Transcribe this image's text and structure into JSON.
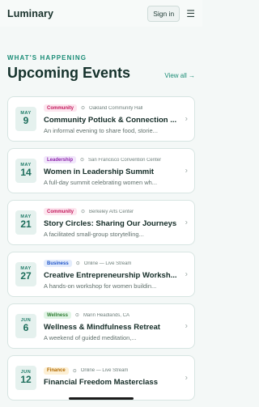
{
  "header": {
    "brand": "Luminary",
    "signin_label": "Sign in",
    "menu_icon": "☰"
  },
  "section": {
    "kicker": "WHAT'S HAPPENING",
    "title": "Upcoming Events",
    "view_all": "View all →"
  },
  "events": [
    {
      "month": "MAY",
      "day": "9",
      "tag": "Community",
      "tag_bg": "#fde6ef",
      "tag_fg": "#c2185b",
      "location": "Oakland Community Hall",
      "title": "Community Potluck & Connection ...",
      "desc": "An informal evening to share food, storie..."
    },
    {
      "month": "MAY",
      "day": "14",
      "tag": "Leadership",
      "tag_bg": "#f1e6fb",
      "tag_fg": "#8e24aa",
      "location": "San Francisco Convention Center",
      "title": "Women in Leadership Summit",
      "desc": "A full-day summit celebrating women wh..."
    },
    {
      "month": "MAY",
      "day": "21",
      "tag": "Community",
      "tag_bg": "#fde6ef",
      "tag_fg": "#c2185b",
      "location": "Berkeley Arts Center",
      "title": "Story Circles: Sharing Our Journeys",
      "desc": "A facilitated small-group storytelling..."
    },
    {
      "month": "MAY",
      "day": "27",
      "tag": "Business",
      "tag_bg": "#e3ecfc",
      "tag_fg": "#1e54c8",
      "location": "Online — Live Stream",
      "title": "Creative Entrepreneurship Worksh...",
      "desc": "A hands-on workshop for women buildin..."
    },
    {
      "month": "JUN",
      "day": "6",
      "tag": "Wellness",
      "tag_bg": "#e2f5e6",
      "tag_fg": "#2e7d32",
      "location": "Marin Headlands, CA",
      "title": "Wellness & Mindfulness Retreat",
      "desc": "A weekend of guided meditation,..."
    },
    {
      "month": "JUN",
      "day": "12",
      "tag": "Finance",
      "tag_bg": "#fdf0d5",
      "tag_fg": "#b26a00",
      "location": "Online — Live Stream",
      "title": "Financial Freedom Masterclass",
      "desc": ""
    }
  ]
}
